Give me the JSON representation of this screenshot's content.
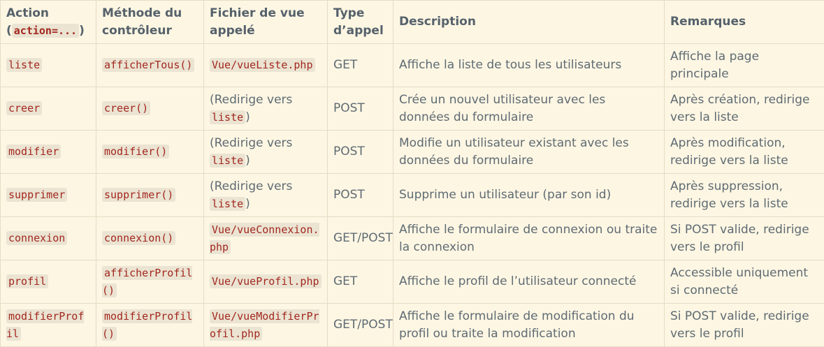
{
  "headers": {
    "action_prefix": "Action",
    "action_open": "(",
    "action_code": "action=...",
    "action_close": ")",
    "method": "Méthode du contrôleur",
    "view": "Fichier de vue appelé",
    "type": "Type d’appel",
    "description": "Description",
    "remarks": "Remarques"
  },
  "rows": [
    {
      "action": "liste",
      "method": "afficherTous()",
      "view_code": "Vue/vueListe.php",
      "type": "GET",
      "description": "Affiche la liste de tous les utilisateurs",
      "remarks": "Affiche la page principale"
    },
    {
      "action": "creer",
      "method": "creer()",
      "view_prefix": "(Redirige vers",
      "view_code": "liste",
      "view_suffix": ")",
      "type": "POST",
      "description": "Crée un nouvel utilisateur avec les données du formulaire",
      "remarks": "Après création, redirige vers la liste"
    },
    {
      "action": "modifier",
      "method": "modifier()",
      "view_prefix": "(Redirige vers",
      "view_code": "liste",
      "view_suffix": ")",
      "type": "POST",
      "description": "Modifie un utilisateur existant avec les données du formulaire",
      "remarks": "Après modification, redirige vers la liste"
    },
    {
      "action": "supprimer",
      "method": "supprimer()",
      "view_prefix": "(Redirige vers",
      "view_code": "liste",
      "view_suffix": ")",
      "type": "POST",
      "description": "Supprime un utilisateur (par son id)",
      "remarks": "Après suppression, redirige vers la liste"
    },
    {
      "action": "connexion",
      "method": "connexion()",
      "view_code": "Vue/vueConnexion.php",
      "type": "GET/POST",
      "description": "Affiche le formulaire de connexion ou traite la connexion",
      "remarks": "Si POST valide, redirige vers le profil"
    },
    {
      "action": "profil",
      "method": "afficherProfil()",
      "view_code": "Vue/vueProfil.php",
      "type": "GET",
      "description": "Affiche le profil de l’utilisateur connecté",
      "remarks": "Accessible uniquement si connecté"
    },
    {
      "action": "modifierProfil",
      "method": "modifierProfil()",
      "view_code": "Vue/vueModifierProfil.php",
      "type": "GET/POST",
      "description": "Affiche le formulaire de modification du profil ou traite la modification",
      "remarks": "Si POST valide, redirige vers le profil"
    }
  ]
}
